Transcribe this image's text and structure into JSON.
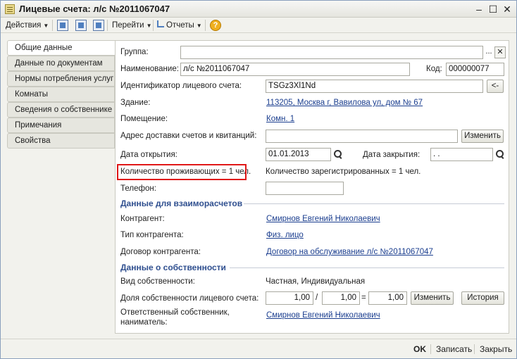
{
  "window": {
    "title": "Лицевые счета: л/с №2011067047",
    "minimize": "–",
    "maximize": "☐",
    "close": "✕"
  },
  "toolbar": {
    "actions": "Действия",
    "goto": "Перейти",
    "reports": "Отчеты",
    "help": "?"
  },
  "tabs": [
    "Общие данные",
    "Данные по документам",
    "Нормы потребления услуг",
    "Комнаты",
    "Сведения о собственнике",
    "Примечания",
    "Свойства"
  ],
  "form": {
    "group_label": "Группа:",
    "group_value": "",
    "group_dots": "...",
    "group_clear": "✕",
    "name_label": "Наименование:",
    "name_value": "л/с №2011067047",
    "code_label": "Код:",
    "code_value": "000000077",
    "account_id_label": "Идентификатор лицевого счета:",
    "account_id_value": "TSGz3Xl1Nd",
    "account_id_btn": "<-",
    "building_label": "Здание:",
    "building_value": "113205, Москва г, Вавилова ул, дом № 67",
    "room_label": "Помещение:",
    "room_value": "Комн. 1",
    "delivery_label": "Адрес доставки счетов и квитанций:",
    "delivery_value": "",
    "delivery_btn": "Изменить",
    "open_date_label": "Дата открытия:",
    "open_date_value": "01.01.2013",
    "close_date_label": "Дата закрытия:",
    "close_date_value": " .  .",
    "residents_label": "Количество проживающих = 1 чел.",
    "registered_label": "Количество зарегистрированных = 1 чел.",
    "phone_label": "Телефон:",
    "phone_value": ""
  },
  "settlements": {
    "title": "Данные для взаиморасчетов",
    "contractor_label": "Контрагент:",
    "contractor_value": "Смирнов Евгений Николаевич",
    "contractor_type_label": "Тип контрагента:",
    "contractor_type_value": "Физ. лицо",
    "contract_label": "Договор контрагента:",
    "contract_value": "Договор на обслуживание л/с №2011067047"
  },
  "ownership": {
    "title": "Данные о собственности",
    "kind_label": "Вид собственности:",
    "kind_value": "Частная, Индивидуальная",
    "share_label": "Доля собственности лицевого счета:",
    "share_num": "1,00",
    "share_den": "1,00",
    "share_result": "1,00",
    "share_slash": "/",
    "share_eq": "=",
    "change_btn": "Изменить",
    "history_btn": "История",
    "owner_label_1": "Ответственный собственник,",
    "owner_label_2": "наниматель:",
    "owner_value": "Смирнов Евгений Николаевич"
  },
  "footer": {
    "ok": "OK",
    "save": "Записать",
    "close": "Закрыть"
  }
}
